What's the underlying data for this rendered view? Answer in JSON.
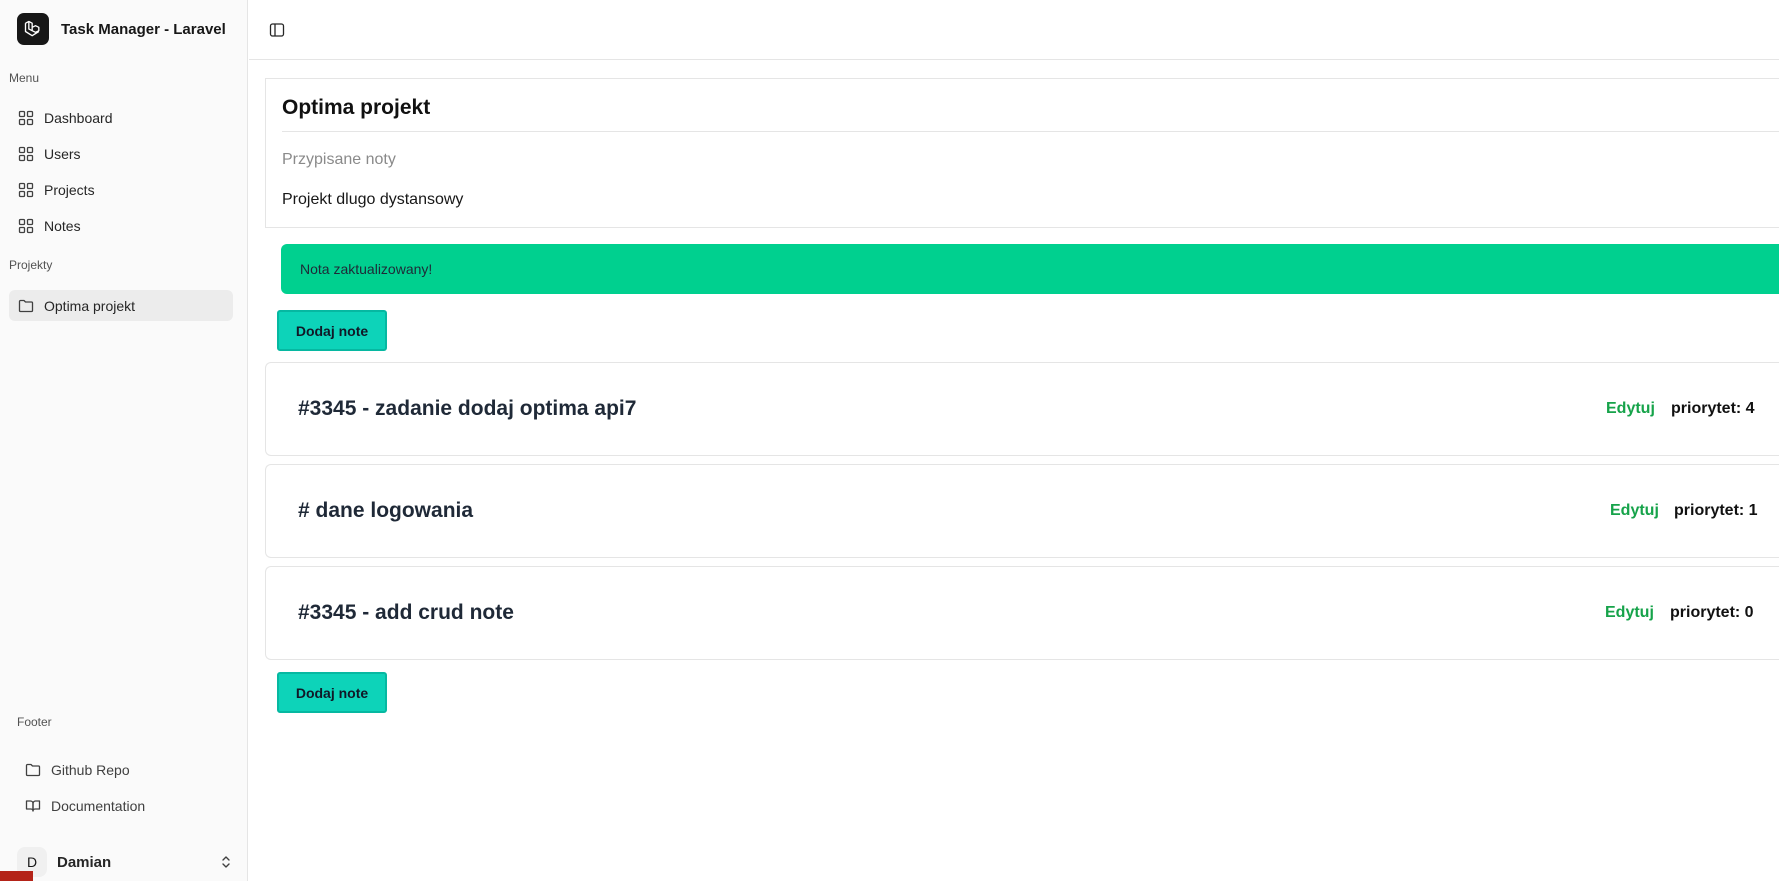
{
  "app": {
    "title": "Task Manager - Laravel",
    "logo_icon": "laravel-logo-icon"
  },
  "sidebar": {
    "menu_label": "Menu",
    "menu_items": [
      {
        "label": "Dashboard",
        "icon": "grid-icon"
      },
      {
        "label": "Users",
        "icon": "grid-icon"
      },
      {
        "label": "Projects",
        "icon": "grid-icon"
      },
      {
        "label": "Notes",
        "icon": "grid-icon"
      }
    ],
    "projects_label": "Projekty",
    "projects": [
      {
        "label": "Optima projekt",
        "icon": "folder-icon",
        "active": true
      }
    ],
    "footer_label": "Footer",
    "footer_items": [
      {
        "label": "Github Repo",
        "icon": "folder-icon"
      },
      {
        "label": "Documentation",
        "icon": "book-icon"
      }
    ],
    "user": {
      "initial": "D",
      "name": "Damian"
    }
  },
  "project": {
    "title": "Optima projekt",
    "assigned_label": "Przypisane noty",
    "description": "Projekt dlugo dystansowy"
  },
  "alert": {
    "message": "Nota zaktualizowany!",
    "color": "#00d08f"
  },
  "add_note_label": "Dodaj note",
  "notes": [
    {
      "title": "#3345 - zadanie dodaj optima api7",
      "edit_label": "Edytuj",
      "priority": "priorytet: 4"
    },
    {
      "title": "# dane logowania",
      "edit_label": "Edytuj",
      "priority": "priorytet: 1"
    },
    {
      "title": "#3345 - add crud note",
      "edit_label": "Edytuj",
      "priority": "priorytet: 0"
    }
  ],
  "colors": {
    "accent_button": "#0dd3b9",
    "edit_link": "#16a34a"
  }
}
